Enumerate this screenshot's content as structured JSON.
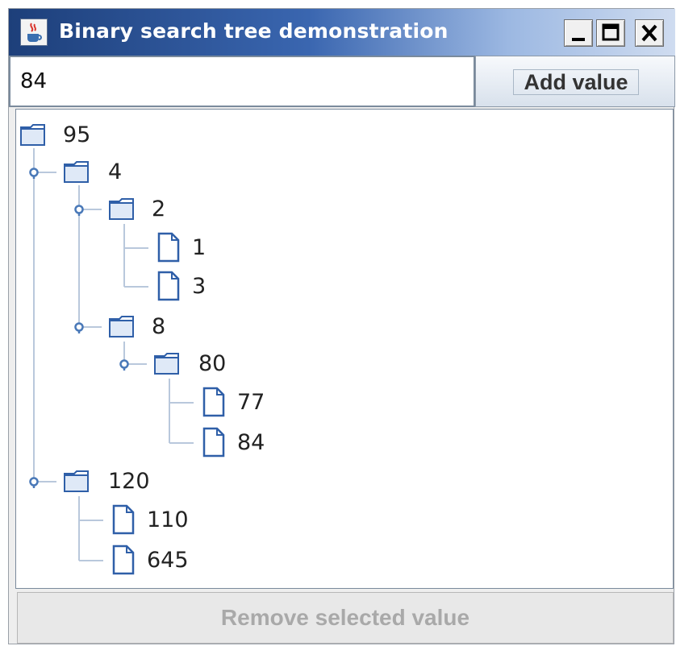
{
  "window": {
    "title": "Binary search tree demonstration",
    "app_icon": "java-cup-icon",
    "controls": [
      "minimize-icon",
      "maximize-icon",
      "close-icon"
    ]
  },
  "input": {
    "value": "84"
  },
  "add_button": {
    "label": "Add value"
  },
  "tree": {
    "nodes": [
      {
        "label": "95",
        "type": "folder"
      },
      {
        "label": "4",
        "type": "folder"
      },
      {
        "label": "2",
        "type": "folder"
      },
      {
        "label": "1",
        "type": "leaf"
      },
      {
        "label": "3",
        "type": "leaf"
      },
      {
        "label": "8",
        "type": "folder"
      },
      {
        "label": "80",
        "type": "folder"
      },
      {
        "label": "77",
        "type": "leaf"
      },
      {
        "label": "84",
        "type": "leaf"
      },
      {
        "label": "120",
        "type": "folder"
      },
      {
        "label": "110",
        "type": "leaf"
      },
      {
        "label": "645",
        "type": "leaf"
      }
    ]
  },
  "remove_button": {
    "label": "Remove selected value",
    "enabled": false
  },
  "colors": {
    "title_start": "#1d3f7a",
    "title_end": "#cfdcf0",
    "tree_line": "#b9c8dc",
    "handle": "#4a79b8",
    "icon_stroke": "#2f5fa8"
  }
}
